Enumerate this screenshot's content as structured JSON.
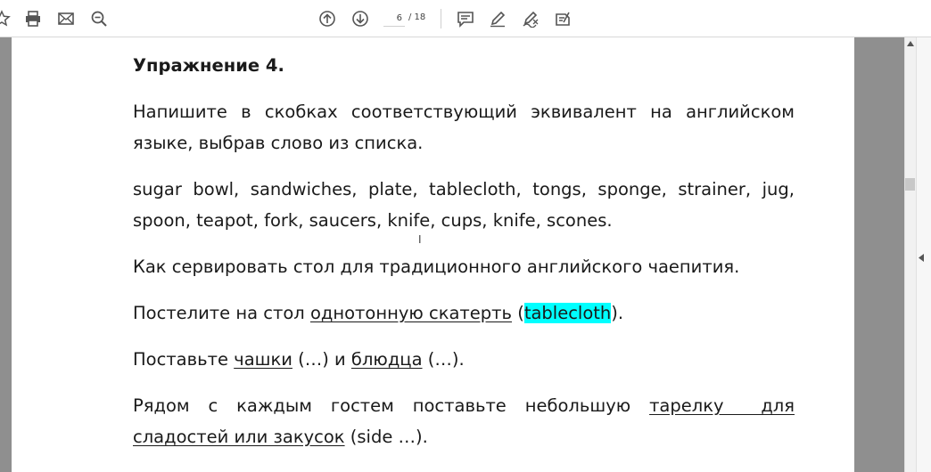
{
  "toolbar": {
    "current_page": "6",
    "total_pages": "/ 18"
  },
  "document": {
    "heading": "Упражнение 4.",
    "instruction_line1": "Напишите в скобках соответствующий эквивалент на английском",
    "instruction_line2": "языке, выбрав слово из списка.",
    "wordlist_line1": "sugar bowl, sandwiches, plate, tablecloth, tongs, sponge, strainer, jug,",
    "wordlist_line2": "spoon, teapot, fork, saucers, knife, cups, knife, scones.",
    "topic": "Как сервировать стол для традиционного английского чаепития.",
    "s1_prefix": "Постелите на стол ",
    "s1_underlined": "однотонную скатерть",
    "s1_open": " (",
    "s1_answer": "tablecloth",
    "s1_close": ").",
    "s2_prefix": "Поставьте ",
    "s2_underlined1": "чашки",
    "s2_middle": " (…) и ",
    "s2_underlined2": "блюдца",
    "s2_suffix": " (…).",
    "s3_line1_prefix": "Рядом с каждым гостем поставьте небольшую ",
    "s3_line1_underlined": "тарелку  для",
    "s3_line2_underlined": "сладостей или закусок",
    "s3_line2_suffix": " (side …)."
  },
  "colors": {
    "highlight": "#00ffff",
    "gutter": "#8f8f8f"
  },
  "icons": [
    "star-icon",
    "print-icon",
    "mail-icon",
    "zoom-icon",
    "arrow-up-icon",
    "arrow-down-icon",
    "comment-icon",
    "pen-icon",
    "sign-icon",
    "stamp-icon",
    "chevron-up-icon",
    "chevron-left-icon"
  ]
}
